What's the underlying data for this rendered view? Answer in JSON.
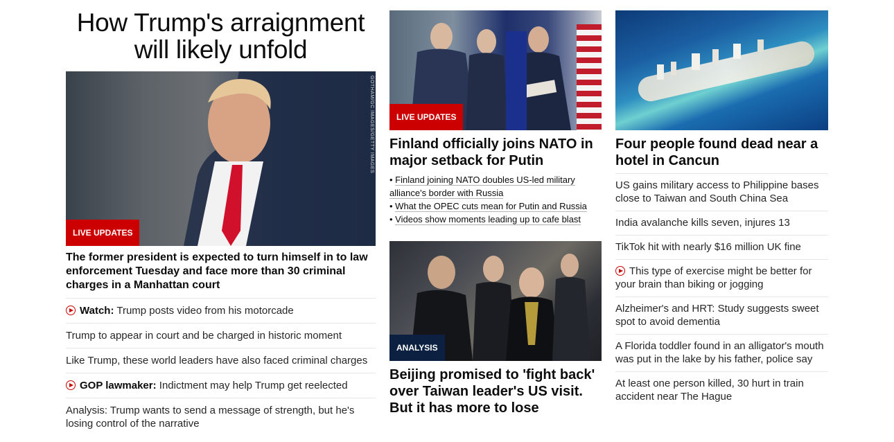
{
  "col1": {
    "headline": "How Trump's arraignment will likely unfold",
    "photo_credit": "GOTHAM/GC IMAGES/GETTY IMAGES",
    "badge": "LIVE UPDATES",
    "lead": "The former president is expected to turn himself in to law enforcement Tuesday and face more than 30 criminal charges in a Manhattan court",
    "links": [
      {
        "prefix": "Watch:",
        "text": " Trump posts video from his motorcade",
        "video": true
      },
      {
        "prefix": "",
        "text": "Trump to appear in court and be charged in historic moment",
        "video": false
      },
      {
        "prefix": "",
        "text": "Like Trump, these world leaders have also faced criminal charges",
        "video": false
      },
      {
        "prefix": "GOP lawmaker:",
        "text": " Indictment may help Trump get reelected",
        "video": true
      },
      {
        "prefix": "",
        "text": "Analysis: Trump wants to send a message of strength, but he's losing control of the narrative",
        "video": false
      }
    ]
  },
  "col2": {
    "nato": {
      "badge": "LIVE UPDATES",
      "headline": "Finland officially joins NATO in major setback for Putin",
      "bullets": [
        "Finland joining NATO doubles US-led military alliance's border with Russia",
        "What the OPEC cuts mean for Putin and Russia",
        "Videos show moments leading up to cafe blast"
      ]
    },
    "taiwan": {
      "badge": "ANALYSIS",
      "headline": "Beijing promised to 'fight back' over Taiwan leader's US visit. But it has more to lose"
    }
  },
  "col3": {
    "headline": "Four people found dead near a hotel in Cancun",
    "links": [
      {
        "text": "US gains military access to Philippine bases close to Taiwan and South China Sea",
        "video": false
      },
      {
        "text": "India avalanche kills seven, injures 13",
        "video": false
      },
      {
        "text": "TikTok hit with nearly $16 million UK fine",
        "video": false
      },
      {
        "text": "This type of exercise might be better for your brain than biking or jogging",
        "video": true
      },
      {
        "text": "Alzheimer's and HRT: Study suggests sweet spot to avoid dementia",
        "video": false
      },
      {
        "text": "A Florida toddler found in an alligator's mouth was put in the lake by his father, police say",
        "video": false
      },
      {
        "text": "At least one person killed, 30 hurt in train accident near The Hague",
        "video": false
      }
    ]
  },
  "colors": {
    "accent_red": "#cc0000",
    "badge_dark": "#0c2141",
    "divider": "#e6e6e6"
  }
}
